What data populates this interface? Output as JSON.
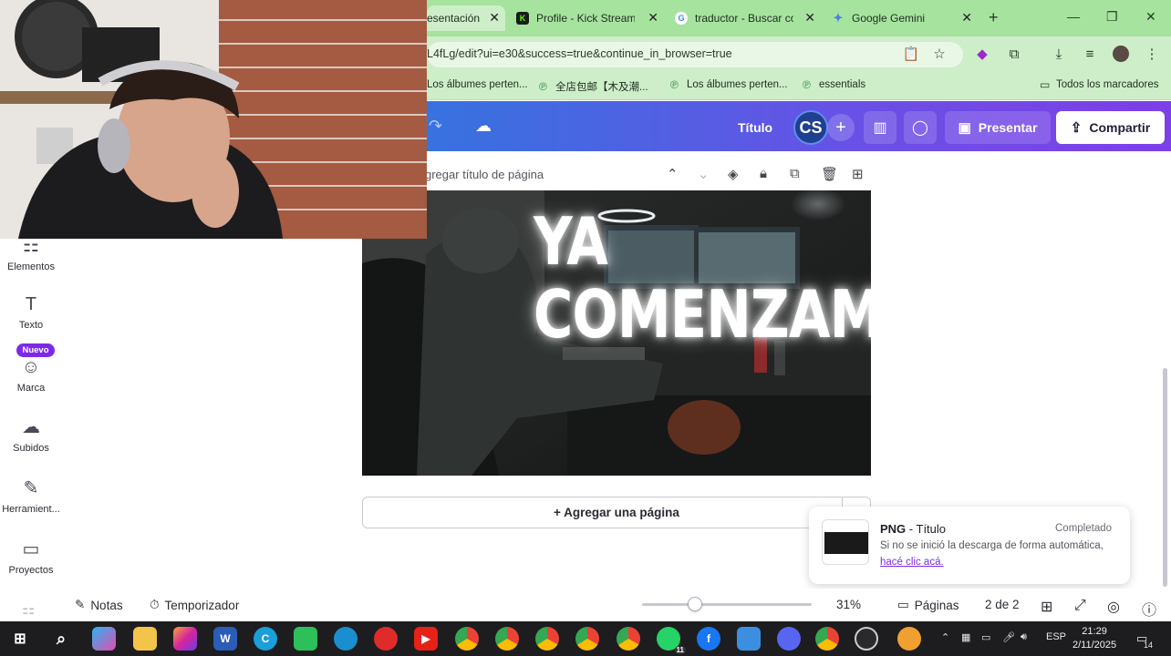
{
  "browser": {
    "tabs": [
      {
        "label": "esentación",
        "active": true,
        "favicon": "canva-icon"
      },
      {
        "label": "Profile - Kick Streame",
        "active": false,
        "favicon": "kick-icon"
      },
      {
        "label": "traductor - Buscar co",
        "active": false,
        "favicon": "google-icon"
      },
      {
        "label": "Google Gemini",
        "active": false,
        "favicon": "gemini-icon"
      }
    ],
    "close_glyph": "✕",
    "url": "L4fLg/edit?ui=e30&success=true&continue_in_browser=true",
    "bookmarks": [
      {
        "label": "Los álbumes perten..."
      },
      {
        "label": "全店包邮【木及潮..."
      },
      {
        "label": "Los álbumes perten..."
      },
      {
        "label": "essentials"
      }
    ],
    "all_bookmarks": "Todos los marcadores"
  },
  "canva": {
    "header": {
      "title": "Título",
      "avatar_initials": "CS",
      "present_label": "Presentar",
      "share_label": "Compartir"
    },
    "sidebar": {
      "items": [
        {
          "label": "Elementos",
          "icon": "elements-icon"
        },
        {
          "label": "Texto",
          "icon": "text-icon"
        },
        {
          "label": "Marca",
          "icon": "brand-icon"
        },
        {
          "label": "Subidos",
          "icon": "upload-icon"
        },
        {
          "label": "Herramient...",
          "icon": "tools-icon"
        },
        {
          "label": "Proyectos",
          "icon": "folder-icon"
        }
      ],
      "new_badge": "Nuevo"
    },
    "page": {
      "title_placeholder": "gregar título de página",
      "slide_line1": "YA",
      "slide_line2": "COMENZAMOS",
      "add_page": "+ Agregar una página"
    },
    "toast": {
      "format": "PNG",
      "separator": " - ",
      "title": "Título",
      "status": "Completado",
      "message": "Si no se inició la descarga de forma automática,",
      "link": "hacé clic acá",
      "link_suffix": "."
    },
    "bottom": {
      "notes_label": "Notas",
      "timer_label": "Temporizador",
      "zoom": "31%",
      "zoom_fraction": 0.31,
      "pages_label": "Páginas",
      "page_count": "2 de 2"
    }
  },
  "taskbar": {
    "language": "ESP",
    "time": "21:29",
    "date": "2/11/2025",
    "notifications": "14",
    "whatsapp_badge": "11"
  }
}
